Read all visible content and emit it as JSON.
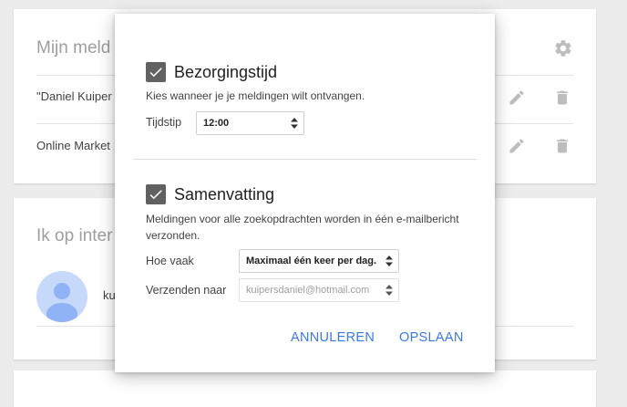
{
  "background": {
    "card1": {
      "title": "Mijn meld",
      "rows": [
        {
          "text": "\"Daniel Kuiper"
        },
        {
          "text": "Online Market"
        }
      ]
    },
    "card2": {
      "title": "Ik op inter",
      "account_text": "ku"
    }
  },
  "modal": {
    "delivery": {
      "checked": true,
      "title": "Bezorgingstijd",
      "description": "Kies wanneer je je meldingen wilt ontvangen.",
      "time_label": "Tijdstip",
      "time_value": "12:00"
    },
    "summary": {
      "checked": true,
      "title": "Samenvatting",
      "description_line1": "Meldingen voor alle zoekopdrachten worden in één e-mailbericht",
      "description_line2": "verzonden.",
      "frequency_label": "Hoe vaak",
      "frequency_value": "Maximaal één keer per dag.",
      "send_to_label": "Verzenden naar",
      "send_to_value": "kuipersdaniel@hotmail.com"
    },
    "buttons": {
      "cancel": "ANNULEREN",
      "save": "OPSLAAN"
    }
  },
  "colors": {
    "accent": "#3b78e7",
    "checkbox": "#616161",
    "icon_gray": "#bdbdbd"
  },
  "icons": [
    "gear-icon",
    "pencil-icon",
    "trash-icon",
    "avatar-icon",
    "checkbox-checked-icon",
    "select-arrows-icon"
  ]
}
